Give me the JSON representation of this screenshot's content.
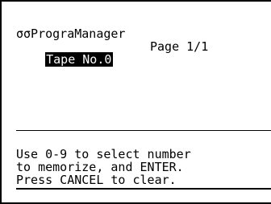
{
  "header": {
    "title": "σσPrograManager",
    "tape_label": "Tape No.0",
    "page_label": "Page 1/1"
  },
  "help": {
    "line1": "Use 0-9 to select number",
    "line2": "to memorize, and ENTER.",
    "line3": "Press CANCEL to clear."
  }
}
